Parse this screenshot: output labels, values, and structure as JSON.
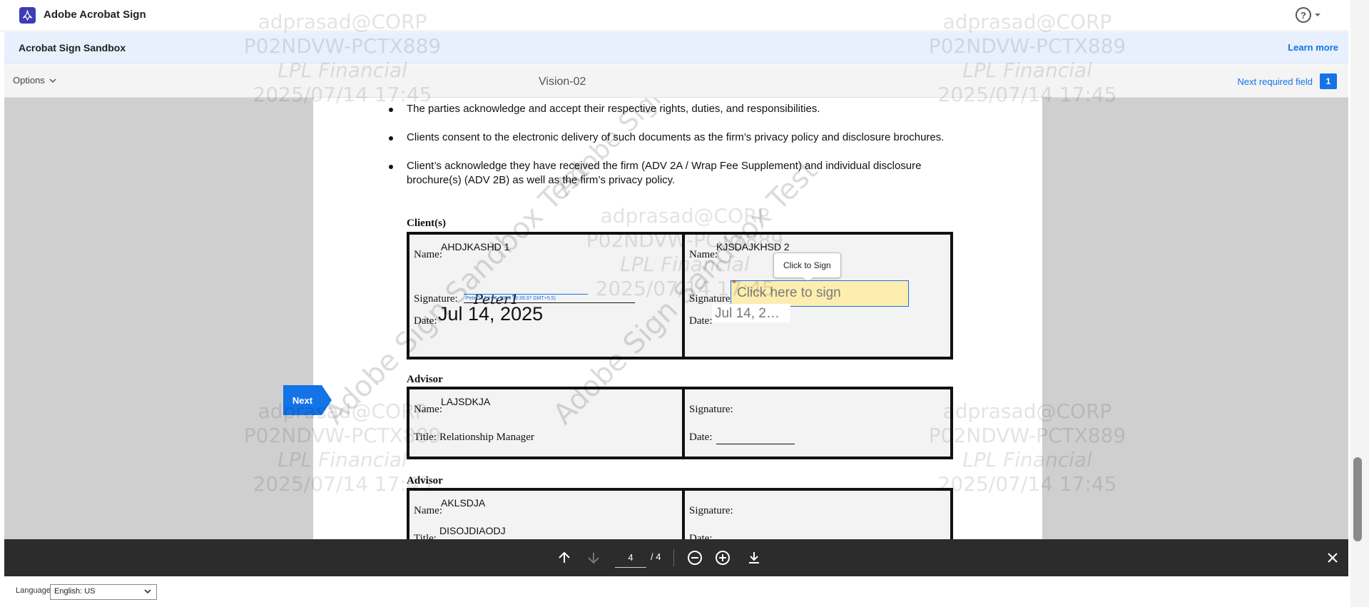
{
  "app": {
    "title": "Adobe Acrobat Sign",
    "help": "?"
  },
  "banner": {
    "title": "Acrobat Sign Sandbox",
    "learn_more": "Learn more"
  },
  "optbar": {
    "options_label": "Options",
    "document_title": "Vision-02",
    "next_required_label": "Next required field",
    "next_required_count": "1"
  },
  "document": {
    "bullets": [
      "The parties acknowledge and accept their respective rights, duties, and responsibilities.",
      "Clients consent to the electronic delivery of such documents as the firm’s privacy policy and disclosure brochures.",
      "Client’s acknowledge they have received the firm (ADV 2A / Wrap Fee Supplement) and individual disclosure brochure(s) (ADV 2B) as well as the firm’s privacy policy."
    ],
    "clients_heading": "Client(s)",
    "client1": {
      "name_label": "Name:",
      "name": "AHDJKASHD 1",
      "signature_label": "Signature:",
      "signature": "Peter1",
      "signature_stamp": "Peter1 (Jul 14, 2025 19:39:37 GMT+5.5)",
      "date_label": "Date:",
      "date": "Jul 14, 2025"
    },
    "client2": {
      "name_label": "Name:",
      "name": "KJSDAJKHSD 2",
      "signature_label": "Signature:",
      "sign_placeholder": "Click here to sign",
      "required_mark": "*",
      "tooltip": "Click to Sign",
      "date_label": "Date:",
      "date": "Jul 14, 2…"
    },
    "advisor1": {
      "heading": "Advisor",
      "name_label": "Name:",
      "name": "LAJSDKJA",
      "title_label": "Title:",
      "title": "Relationship Manager",
      "signature_label": "Signature:",
      "date_label": "Date:"
    },
    "advisor2": {
      "heading": "Advisor",
      "name_label": "Name:",
      "name": "AKLSDJA",
      "title_label": "Title:",
      "title": "DISOJDIAODJ",
      "signature_label": "Signature:",
      "date_label": "Date:"
    }
  },
  "next_button": "Next",
  "watermark": {
    "lines": [
      "adprasad@CORP",
      "P02NDVW-PCTX889",
      "LPL Financial",
      "2025/07/14 17:45"
    ],
    "diagonal": "Adobe Sign Sandbox Test"
  },
  "toolbar": {
    "current_page": "4",
    "total_pages": "/ 4"
  },
  "footer": {
    "language_label": "Language",
    "language_value": "English: US"
  }
}
